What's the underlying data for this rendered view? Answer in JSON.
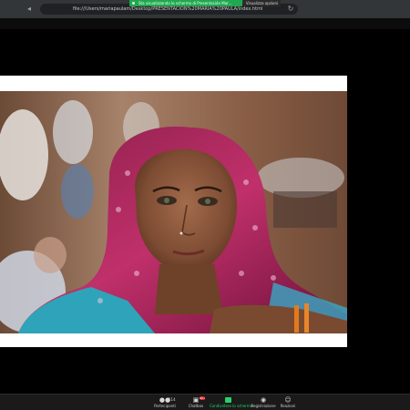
{
  "browser": {
    "url": "file:///Users/mariapaulam/Desktop/PRESENTACION%20MARIA%20PAULA/index.html"
  },
  "share_banner": {
    "text": "Sta visualizzando lo schermo di Presentación Mar..."
  },
  "view_options": {
    "label": "Visualizza opzioni"
  },
  "toolbar": {
    "participants_label": "Partecipanti",
    "participants_count": "114",
    "chat_label": "Chatbox",
    "chat_badge": "99+",
    "share_label": "Condividere lo schermo",
    "record_label": "Registrazione",
    "reactions_label": "Reazioni"
  },
  "colors": {
    "share_green": "#25d366",
    "badge_red": "#e02828"
  },
  "icons": [
    "back-arrow-icon",
    "reload-icon",
    "participants-icon",
    "chat-icon",
    "share-screen-icon",
    "record-icon",
    "reactions-icon"
  ]
}
